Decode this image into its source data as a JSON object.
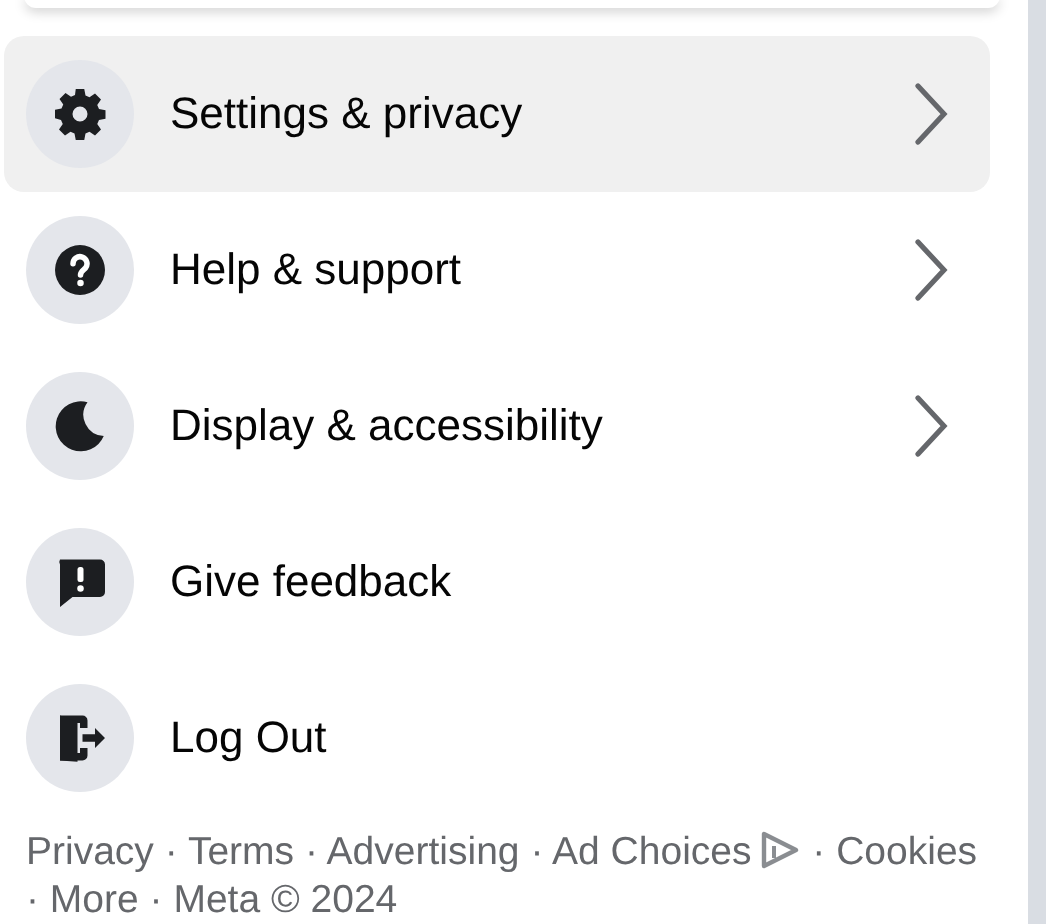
{
  "menu": [
    {
      "label": "Settings & privacy",
      "chevron": true,
      "selected": true
    },
    {
      "label": "Help & support",
      "chevron": true,
      "selected": false
    },
    {
      "label": "Display & accessibility",
      "chevron": true,
      "selected": false
    },
    {
      "label": "Give feedback",
      "chevron": false,
      "selected": false
    },
    {
      "label": "Log Out",
      "chevron": false,
      "selected": false
    }
  ],
  "footer": [
    {
      "text": "Privacy",
      "kind": "link"
    },
    {
      "text": "·",
      "kind": "separator"
    },
    {
      "text": "Terms",
      "kind": "link"
    },
    {
      "text": "·",
      "kind": "separator"
    },
    {
      "text": "Advertising",
      "kind": "link"
    },
    {
      "text": "·",
      "kind": "separator"
    },
    {
      "text": "Ad Choices",
      "kind": "adchoices"
    },
    {
      "text": "·",
      "kind": "separator"
    },
    {
      "text": "Cookies",
      "kind": "link"
    },
    {
      "text": "·",
      "kind": "separator"
    },
    {
      "text": "More",
      "kind": "link"
    },
    {
      "text": "·",
      "kind": "separator"
    },
    {
      "text": "Meta © 2024",
      "kind": "text"
    }
  ]
}
